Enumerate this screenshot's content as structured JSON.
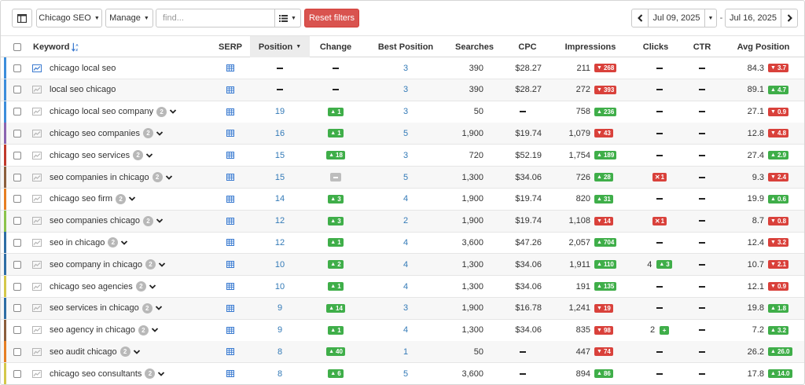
{
  "toolbar": {
    "project_label": "Chicago SEO",
    "manage_label": "Manage",
    "find_placeholder": "find...",
    "reset_label": "Reset filters",
    "date_start": "Jul 09, 2025",
    "date_separator": "-",
    "date_end": "Jul 16, 2025"
  },
  "columns": {
    "keyword": "Keyword",
    "serp": "SERP",
    "position": "Position",
    "change": "Change",
    "best_position": "Best Position",
    "searches": "Searches",
    "cpc": "CPC",
    "impressions": "Impressions",
    "clicks": "Clicks",
    "ctr": "CTR",
    "avg_position": "Avg Position"
  },
  "colors": {
    "up": "#3fae49",
    "down": "#d9413b",
    "link": "#337ab7",
    "danger": "#d9534f"
  },
  "rows": [
    {
      "keyword": "chicago local seo",
      "group": "",
      "bar": "#3c8ddb",
      "icon_active": true,
      "position": "–",
      "change": "–",
      "change_dir": "none",
      "best": "3",
      "searches": "390",
      "cpc": "$28.27",
      "impressions": "211",
      "imp_change": "268",
      "imp_dir": "down",
      "clicks": "–",
      "click_change": "",
      "click_dir": "none",
      "ctr": "–",
      "avg": "84.3",
      "avg_change": "3.7",
      "avg_dir": "down"
    },
    {
      "keyword": "local seo chicago",
      "group": "",
      "bar": "#3c8ddb",
      "icon_active": false,
      "position": "–",
      "change": "–",
      "change_dir": "none",
      "best": "3",
      "searches": "390",
      "cpc": "$28.27",
      "impressions": "272",
      "imp_change": "393",
      "imp_dir": "down",
      "clicks": "–",
      "click_change": "",
      "click_dir": "none",
      "ctr": "–",
      "avg": "89.1",
      "avg_change": "4.7",
      "avg_dir": "up"
    },
    {
      "keyword": "chicago local seo company",
      "group": "2",
      "bar": "#3c8ddb",
      "icon_active": false,
      "position": "19",
      "change": "1",
      "change_dir": "up",
      "best": "3",
      "searches": "50",
      "cpc": "–",
      "impressions": "758",
      "imp_change": "236",
      "imp_dir": "up",
      "clicks": "–",
      "click_change": "",
      "click_dir": "none",
      "ctr": "–",
      "avg": "27.1",
      "avg_change": "0.9",
      "avg_dir": "down"
    },
    {
      "keyword": "chicago seo companies",
      "group": "2",
      "bar": "#8a64b0",
      "icon_active": false,
      "position": "16",
      "change": "1",
      "change_dir": "up",
      "best": "5",
      "searches": "1,900",
      "cpc": "$19.74",
      "impressions": "1,079",
      "imp_change": "43",
      "imp_dir": "down",
      "clicks": "–",
      "click_change": "",
      "click_dir": "none",
      "ctr": "–",
      "avg": "12.8",
      "avg_change": "4.8",
      "avg_dir": "down"
    },
    {
      "keyword": "chicago seo services",
      "group": "2",
      "bar": "#c0392b",
      "icon_active": false,
      "position": "15",
      "change": "18",
      "change_dir": "up",
      "best": "3",
      "searches": "720",
      "cpc": "$52.19",
      "impressions": "1,754",
      "imp_change": "189",
      "imp_dir": "up",
      "clicks": "–",
      "click_change": "",
      "click_dir": "none",
      "ctr": "–",
      "avg": "27.4",
      "avg_change": "2.9",
      "avg_dir": "up"
    },
    {
      "keyword": "seo companies in chicago",
      "group": "2",
      "bar": "#8b5e3c",
      "icon_active": false,
      "position": "15",
      "change": "",
      "change_dir": "neutral",
      "best": "5",
      "searches": "1,300",
      "cpc": "$34.06",
      "impressions": "726",
      "imp_change": "28",
      "imp_dir": "up",
      "clicks": "",
      "click_change": "1",
      "click_dir": "down",
      "ctr": "–",
      "avg": "9.3",
      "avg_change": "2.4",
      "avg_dir": "down"
    },
    {
      "keyword": "chicago seo firm",
      "group": "2",
      "bar": "#e67e22",
      "icon_active": false,
      "position": "14",
      "change": "3",
      "change_dir": "up",
      "best": "4",
      "searches": "1,900",
      "cpc": "$19.74",
      "impressions": "820",
      "imp_change": "31",
      "imp_dir": "up",
      "clicks": "–",
      "click_change": "",
      "click_dir": "none",
      "ctr": "–",
      "avg": "19.9",
      "avg_change": "0.6",
      "avg_dir": "up"
    },
    {
      "keyword": "seo companies chicago",
      "group": "2",
      "bar": "#8bc34a",
      "icon_active": false,
      "position": "12",
      "change": "3",
      "change_dir": "up",
      "best": "2",
      "searches": "1,900",
      "cpc": "$19.74",
      "impressions": "1,108",
      "imp_change": "14",
      "imp_dir": "down",
      "clicks": "",
      "click_change": "1",
      "click_dir": "down",
      "ctr": "–",
      "avg": "8.7",
      "avg_change": "0.8",
      "avg_dir": "down"
    },
    {
      "keyword": "seo in chicago",
      "group": "2",
      "bar": "#2e6da4",
      "icon_active": false,
      "position": "12",
      "change": "1",
      "change_dir": "up",
      "best": "4",
      "searches": "3,600",
      "cpc": "$47.26",
      "impressions": "2,057",
      "imp_change": "704",
      "imp_dir": "up",
      "clicks": "–",
      "click_change": "",
      "click_dir": "none",
      "ctr": "–",
      "avg": "12.4",
      "avg_change": "3.2",
      "avg_dir": "down"
    },
    {
      "keyword": "seo company in chicago",
      "group": "2",
      "bar": "#2e6da4",
      "icon_active": false,
      "position": "10",
      "change": "2",
      "change_dir": "up",
      "best": "4",
      "searches": "1,300",
      "cpc": "$34.06",
      "impressions": "1,911",
      "imp_change": "110",
      "imp_dir": "up",
      "clicks": "4",
      "click_change": "3",
      "click_dir": "up",
      "ctr": "–",
      "avg": "10.7",
      "avg_change": "2.1",
      "avg_dir": "down"
    },
    {
      "keyword": "chicago seo agencies",
      "group": "2",
      "bar": "#d4c84a",
      "icon_active": false,
      "position": "10",
      "change": "1",
      "change_dir": "up",
      "best": "4",
      "searches": "1,300",
      "cpc": "$34.06",
      "impressions": "191",
      "imp_change": "135",
      "imp_dir": "up",
      "clicks": "–",
      "click_change": "",
      "click_dir": "none",
      "ctr": "–",
      "avg": "12.1",
      "avg_change": "0.9",
      "avg_dir": "down"
    },
    {
      "keyword": "seo services in chicago",
      "group": "2",
      "bar": "#2e6da4",
      "icon_active": false,
      "position": "9",
      "change": "14",
      "change_dir": "up",
      "best": "3",
      "searches": "1,900",
      "cpc": "$16.78",
      "impressions": "1,241",
      "imp_change": "19",
      "imp_dir": "down",
      "clicks": "–",
      "click_change": "",
      "click_dir": "none",
      "ctr": "–",
      "avg": "19.8",
      "avg_change": "1.8",
      "avg_dir": "up"
    },
    {
      "keyword": "seo agency in chicago",
      "group": "2",
      "bar": "#8b5e3c",
      "icon_active": false,
      "position": "9",
      "change": "1",
      "change_dir": "up",
      "best": "4",
      "searches": "1,300",
      "cpc": "$34.06",
      "impressions": "835",
      "imp_change": "98",
      "imp_dir": "down",
      "clicks": "2",
      "click_change": "+",
      "click_dir": "plus",
      "ctr": "–",
      "avg": "7.2",
      "avg_change": "3.2",
      "avg_dir": "up"
    },
    {
      "keyword": "seo audit chicago",
      "group": "2",
      "bar": "#e67e22",
      "icon_active": false,
      "position": "8",
      "change": "40",
      "change_dir": "up",
      "best": "1",
      "searches": "50",
      "cpc": "–",
      "impressions": "447",
      "imp_change": "74",
      "imp_dir": "down",
      "clicks": "–",
      "click_change": "",
      "click_dir": "none",
      "ctr": "–",
      "avg": "26.2",
      "avg_change": "26.0",
      "avg_dir": "up"
    },
    {
      "keyword": "chicago seo consultants",
      "group": "2",
      "bar": "#d4c84a",
      "icon_active": false,
      "position": "8",
      "change": "6",
      "change_dir": "up",
      "best": "5",
      "searches": "3,600",
      "cpc": "–",
      "impressions": "894",
      "imp_change": "86",
      "imp_dir": "up",
      "clicks": "–",
      "click_change": "",
      "click_dir": "none",
      "ctr": "–",
      "avg": "17.8",
      "avg_change": "14.0",
      "avg_dir": "up"
    }
  ]
}
